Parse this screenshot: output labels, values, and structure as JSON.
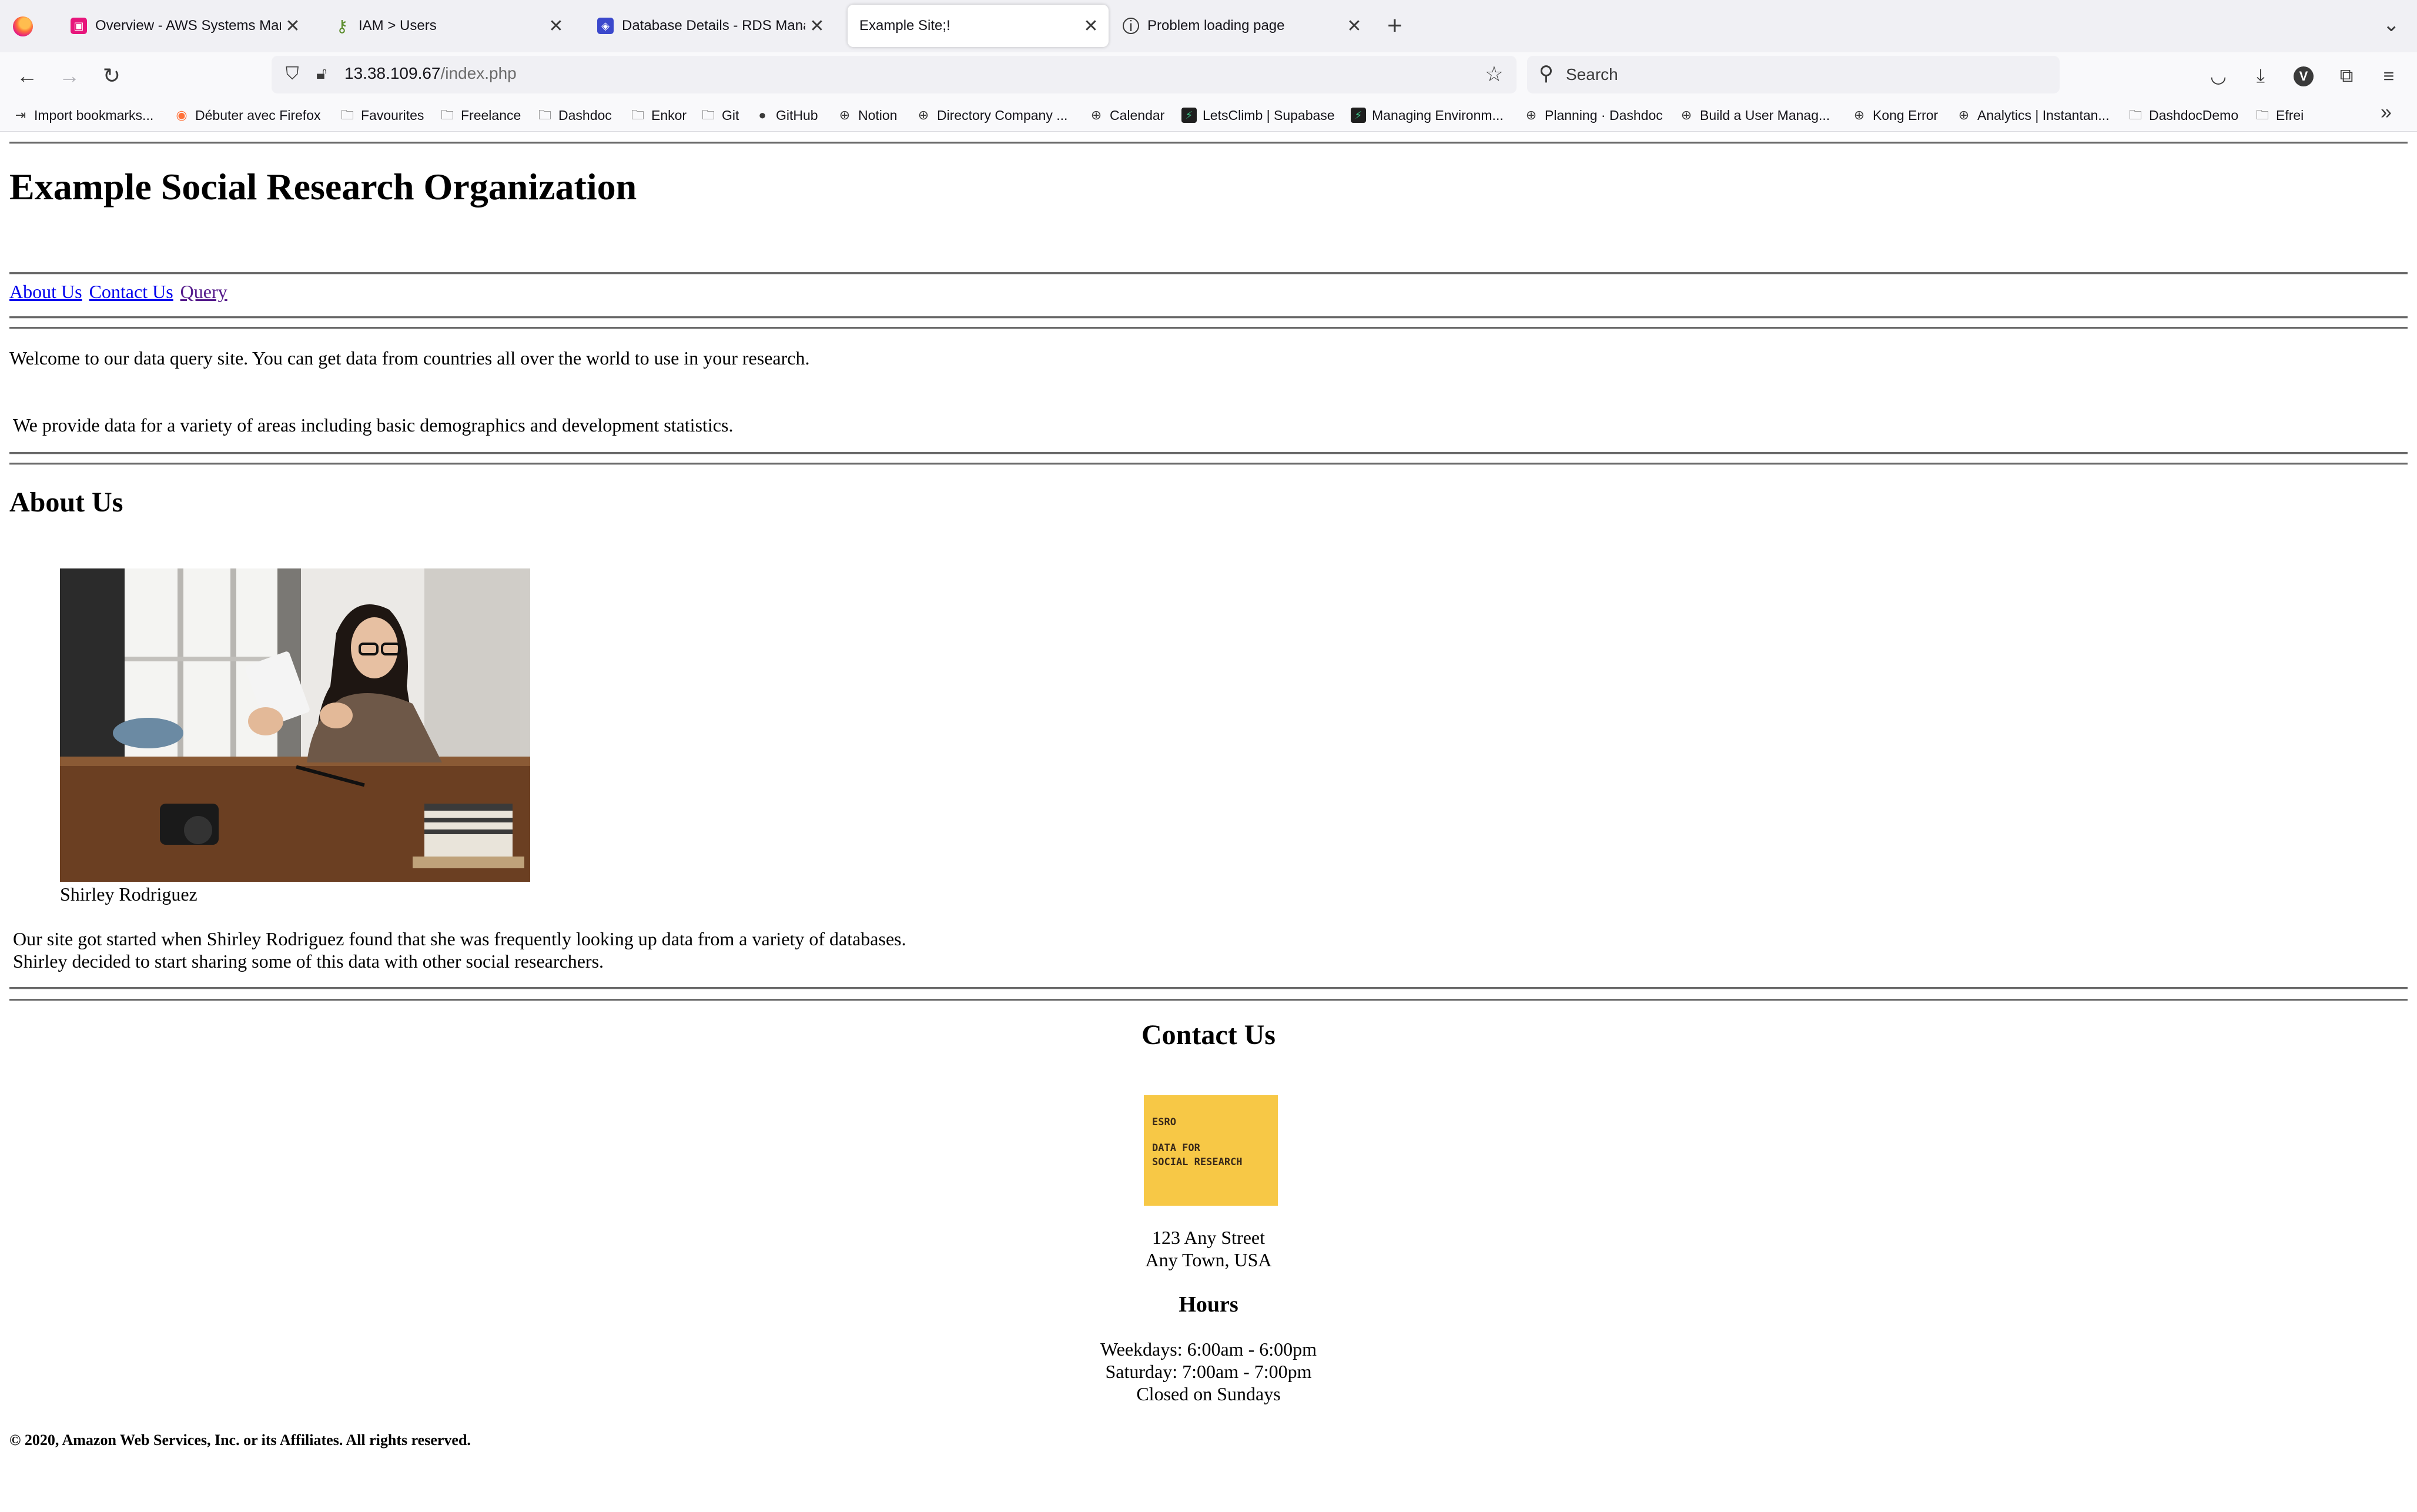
{
  "browser": {
    "tabs": [
      {
        "title": "Overview - AWS Systems Manag",
        "icon": "aws-systems-manager-icon",
        "color": "#e7157b"
      },
      {
        "title": "IAM > Users",
        "icon": "iam-key-icon",
        "color": "#5a8c2a"
      },
      {
        "title": "Database Details - RDS Manage",
        "icon": "rds-icon",
        "color": "#3b48cc"
      },
      {
        "title": "Example Site;!",
        "icon": "",
        "color": ""
      },
      {
        "title": "Problem loading page",
        "icon": "info-circle-icon",
        "color": "#3a3a3a"
      }
    ],
    "url_host": "13.38.109.67",
    "url_path": "/index.php",
    "search_placeholder": "Search",
    "avatar_letter": "V",
    "bookmarks": [
      {
        "label": "Import bookmarks...",
        "icon": "import-icon"
      },
      {
        "label": "Débuter avec Firefox",
        "icon": "firefox-icon"
      },
      {
        "label": "Favourites",
        "icon": "folder-icon"
      },
      {
        "label": "Freelance",
        "icon": "folder-icon"
      },
      {
        "label": "Dashdoc",
        "icon": "folder-icon"
      },
      {
        "label": "Enkor",
        "icon": "folder-icon"
      },
      {
        "label": "Git",
        "icon": "folder-icon"
      },
      {
        "label": "GitHub",
        "icon": "github-icon"
      },
      {
        "label": "Notion",
        "icon": "globe-icon"
      },
      {
        "label": "Directory Company ...",
        "icon": "globe-icon"
      },
      {
        "label": "Calendar",
        "icon": "globe-icon"
      },
      {
        "label": "LetsClimb | Supabase",
        "icon": "supabase-icon"
      },
      {
        "label": "Managing Environm...",
        "icon": "supabase-icon"
      },
      {
        "label": "Planning · Dashdoc",
        "icon": "globe-icon"
      },
      {
        "label": "Build a User Manag...",
        "icon": "globe-icon"
      },
      {
        "label": "Kong Error",
        "icon": "globe-icon"
      },
      {
        "label": "Analytics | Instantan...",
        "icon": "globe-icon"
      },
      {
        "label": "DashdocDemo",
        "icon": "folder-icon"
      },
      {
        "label": "Efrei",
        "icon": "folder-icon"
      }
    ]
  },
  "page": {
    "title": "Example Social Research Organization",
    "nav": [
      "About Us",
      "Contact Us",
      "Query"
    ],
    "welcome": "Welcome to our data query site. You can get data from countries all over the world to use in your research.",
    "provide": "We provide data for a variety of areas including basic demographics and development statistics.",
    "about_heading": "About Us",
    "photo_caption": "Shirley Rodriguez",
    "about_line1": "Our site got started when Shirley Rodriguez found that she was frequently looking up data from a variety of databases.",
    "about_line2": "Shirley decided to start sharing some of this data with other social researchers.",
    "contact_heading": "Contact Us",
    "logo_line1": "ESRO",
    "logo_line2": "DATA FOR",
    "logo_line3": "SOCIAL RESEARCH",
    "address_line1": "123 Any Street",
    "address_line2": "Any Town, USA",
    "hours_heading": "Hours",
    "hours_weekdays": "Weekdays: 6:00am - 6:00pm",
    "hours_saturday": "Saturday: 7:00am - 7:00pm",
    "hours_sunday": "Closed on Sundays",
    "footer": "© 2020, Amazon Web Services, Inc. or its Affiliates. All rights reserved."
  }
}
